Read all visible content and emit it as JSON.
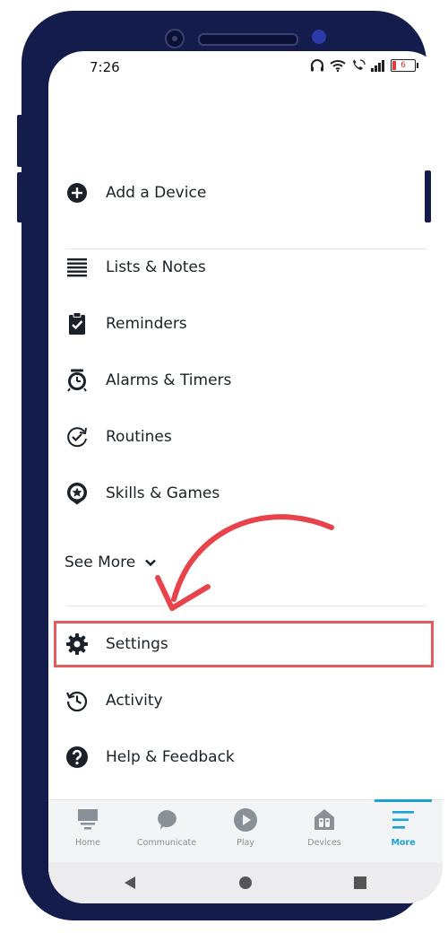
{
  "status_bar": {
    "time": "7:26",
    "battery_level": "6"
  },
  "menu": {
    "add_device": {
      "label": "Add a Device",
      "icon": "plus-circle-icon"
    },
    "items": [
      {
        "label": "Lists & Notes",
        "icon": "list-icon"
      },
      {
        "label": "Reminders",
        "icon": "clipboard-check-icon"
      },
      {
        "label": "Alarms & Timers",
        "icon": "alarm-clock-icon"
      },
      {
        "label": "Routines",
        "icon": "routine-check-icon"
      },
      {
        "label": "Skills & Games",
        "icon": "skills-badge-icon"
      }
    ],
    "see_more": {
      "label": "See More",
      "icon": "chevron-down-icon"
    },
    "settings": {
      "label": "Settings",
      "icon": "gear-icon"
    },
    "activity": {
      "label": "Activity",
      "icon": "history-clock-icon"
    },
    "help": {
      "label": "Help & Feedback",
      "icon": "question-circle-icon"
    }
  },
  "annotation": {
    "highlight_color": "#e45b5f",
    "arrow_color": "#e8434a",
    "target": "Settings"
  },
  "bottom_nav": {
    "items": [
      {
        "label": "Home",
        "icon": "home-icon",
        "active": false
      },
      {
        "label": "Communicate",
        "icon": "chat-bubble-icon",
        "active": false
      },
      {
        "label": "Play",
        "icon": "play-icon",
        "active": false
      },
      {
        "label": "Devices",
        "icon": "devices-icon",
        "active": false
      },
      {
        "label": "More",
        "icon": "menu-lines-icon",
        "active": true
      }
    ],
    "active_color": "#1aa2d4"
  },
  "system_nav": {
    "buttons": [
      "back-icon",
      "home-circle-icon",
      "recents-square-icon"
    ]
  }
}
